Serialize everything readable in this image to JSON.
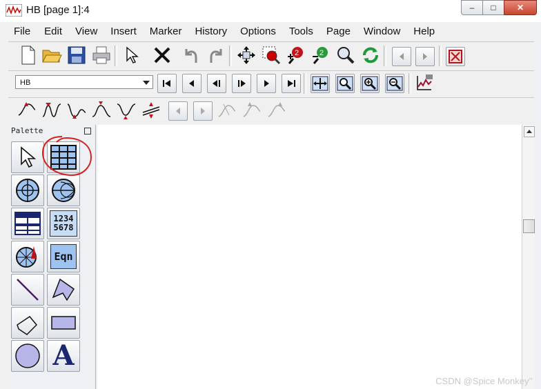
{
  "window": {
    "title": "HB [page 1]:4",
    "minimize": "‒",
    "maximize": "□",
    "close": "✕"
  },
  "menu": [
    "File",
    "Edit",
    "View",
    "Insert",
    "Marker",
    "History",
    "Options",
    "Tools",
    "Page",
    "Window",
    "Help"
  ],
  "dataset_select": {
    "value": "HB"
  },
  "palette": {
    "title": "Palette"
  },
  "palette_items": {
    "numeric_text": "1234\n5678",
    "equation": "Eqn",
    "text_glyph": "A"
  },
  "watermark": "CSDN @Spice Monkey’’"
}
